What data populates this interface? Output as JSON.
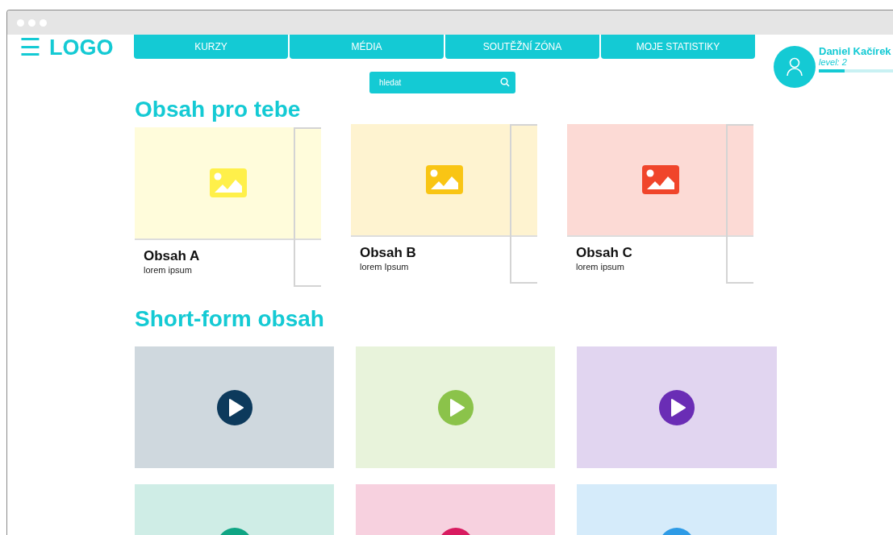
{
  "header": {
    "logo": "LOGO",
    "menu_icon": "☰"
  },
  "nav": [
    {
      "label": "KURZY"
    },
    {
      "label": "MÉDIA"
    },
    {
      "label": "SOUTĚŽNÍ ZÓNA"
    },
    {
      "label": "MOJE STATISTIKY"
    }
  ],
  "search": {
    "placeholder": "hledat"
  },
  "user": {
    "name": "Daniel Kačírek",
    "level_text": "level: 2",
    "level": 0.35
  },
  "sections": [
    {
      "title": "Obsah pro tebe",
      "kind": "content",
      "items": [
        {
          "title": "Obsah A",
          "subtitle": "lorem ipsum",
          "color": "#fff04a"
        },
        {
          "title": "Obsah B",
          "subtitle": "lorem Ipsum",
          "color": "#f9c514"
        },
        {
          "title": "Obsah C",
          "subtitle": "lorem ipsum",
          "color": "#f0452b"
        }
      ]
    },
    {
      "title": "Short-form obsah",
      "kind": "video",
      "items": [
        {
          "color": "#0d3a5c"
        },
        {
          "color": "#8bc34a"
        },
        {
          "color": "#6a2db5"
        },
        {
          "color": "#0fa584"
        },
        {
          "color": "#d81b60"
        },
        {
          "color": "#2e9be6"
        }
      ]
    }
  ]
}
